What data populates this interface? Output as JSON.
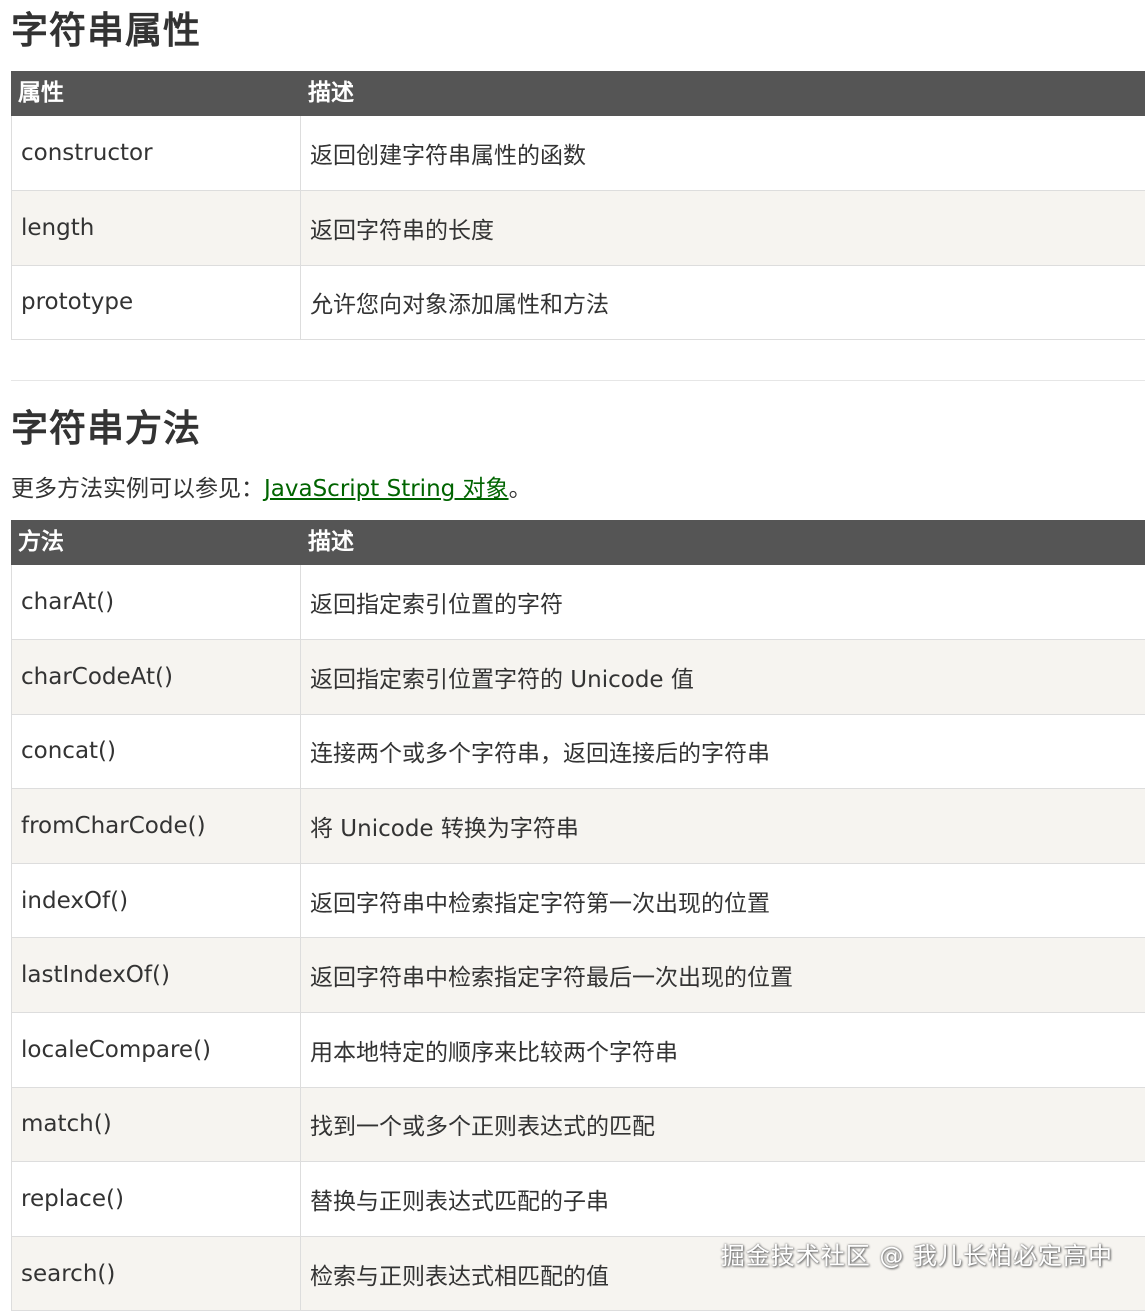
{
  "properties_section": {
    "title": "字符串属性",
    "headers": [
      "属性",
      "描述"
    ],
    "rows": [
      [
        "constructor",
        "返回创建字符串属性的函数"
      ],
      [
        "length",
        "返回字符串的长度"
      ],
      [
        "prototype",
        "允许您向对象添加属性和方法"
      ]
    ]
  },
  "methods_section": {
    "title": "字符串方法",
    "intro_prefix": "更多方法实例可以参见：",
    "intro_link": "JavaScript String 对象",
    "intro_suffix": "。",
    "headers": [
      "方法",
      "描述"
    ],
    "rows": [
      [
        "charAt()",
        "返回指定索引位置的字符"
      ],
      [
        "charCodeAt()",
        "返回指定索引位置字符的 Unicode 值"
      ],
      [
        "concat()",
        "连接两个或多个字符串，返回连接后的字符串"
      ],
      [
        "fromCharCode()",
        "将 Unicode 转换为字符串"
      ],
      [
        "indexOf()",
        "返回字符串中检索指定字符第一次出现的位置"
      ],
      [
        "lastIndexOf()",
        "返回字符串中检索指定字符最后一次出现的位置"
      ],
      [
        "localeCompare()",
        "用本地特定的顺序来比较两个字符串"
      ],
      [
        "match()",
        "找到一个或多个正则表达式的匹配"
      ],
      [
        "replace()",
        "替换与正则表达式匹配的子串"
      ],
      [
        "search()",
        "检索与正则表达式相匹配的值"
      ]
    ]
  },
  "watermark": "掘金技术社区 @ 我儿长柏必定高中",
  "colors": {
    "header_bg": "#555555",
    "row_alt_bg": "#f6f4f0",
    "link": "#006400",
    "text": "#333333"
  }
}
